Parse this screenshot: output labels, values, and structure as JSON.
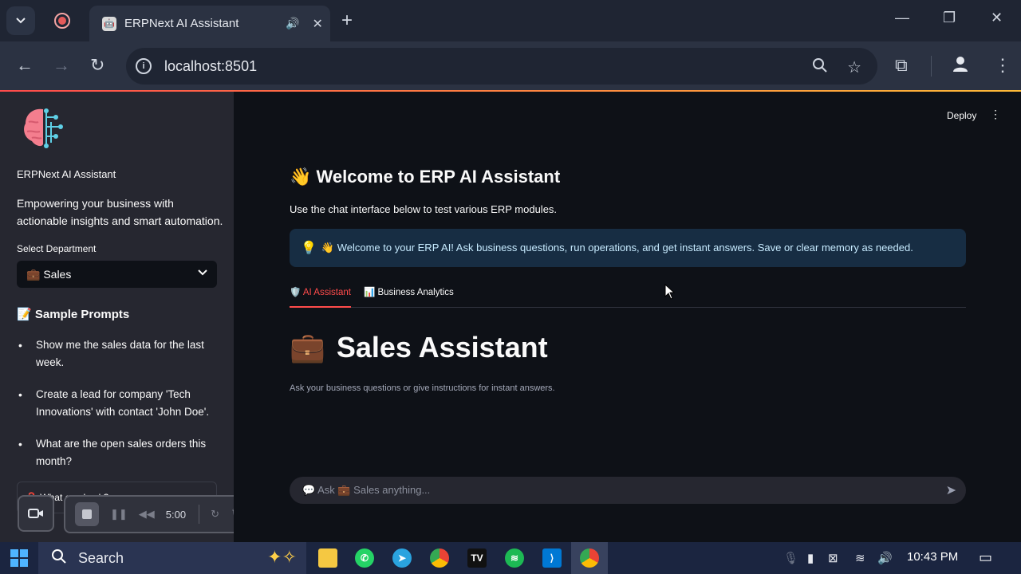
{
  "browser": {
    "tab_title": "ERPNext AI Assistant",
    "url": "localhost:8501",
    "icons": [
      "tab-search-icon",
      "record-icon",
      "audio-icon",
      "close-icon",
      "new-tab-icon",
      "minimize-icon",
      "restore-icon",
      "window-close-icon",
      "back-icon",
      "forward-icon",
      "reload-icon",
      "info-icon",
      "zoom-icon",
      "star-icon",
      "extensions-icon",
      "profile-icon",
      "menu-icon"
    ]
  },
  "sidebar": {
    "app_name": "ERPNext AI Assistant",
    "tagline": "Empowering your business with actionable insights and smart automation.",
    "department_label": "Select Department",
    "department_value": "💼 Sales",
    "prompts_heading": "📝 Sample Prompts",
    "prompts": [
      "Show me the sales data for the last week.",
      "Create a lead for company 'Tech Innovations' with contact 'John Doe'.",
      "What are the open sales orders this month?"
    ],
    "expander_label": "❓ What can I ask?"
  },
  "recorder": {
    "time": "5:00"
  },
  "main": {
    "deploy_label": "Deploy",
    "welcome_title": "👋 Welcome to ERP AI Assistant",
    "welcome_sub": "Use the chat interface below to test various ERP modules.",
    "info_text": "👋 Welcome to your ERP AI! Ask business questions, run operations, and get instant answers. Save or clear memory as needed.",
    "tabs": [
      {
        "label": "🛡️ AI Assistant",
        "active": true
      },
      {
        "label": "📊 Business Analytics",
        "active": false
      }
    ],
    "assistant_title": "Sales Assistant",
    "assistant_sub": "Ask your business questions or give instructions for instant answers.",
    "chat_placeholder": "💬 Ask 💼 Sales anything..."
  },
  "taskbar": {
    "search_label": "Search",
    "time": "10:43 PM"
  },
  "colors": {
    "accent": "#ff4b4b",
    "sidebar_bg": "#262730",
    "main_bg": "#0e1117",
    "info_bg": "#172d43"
  }
}
